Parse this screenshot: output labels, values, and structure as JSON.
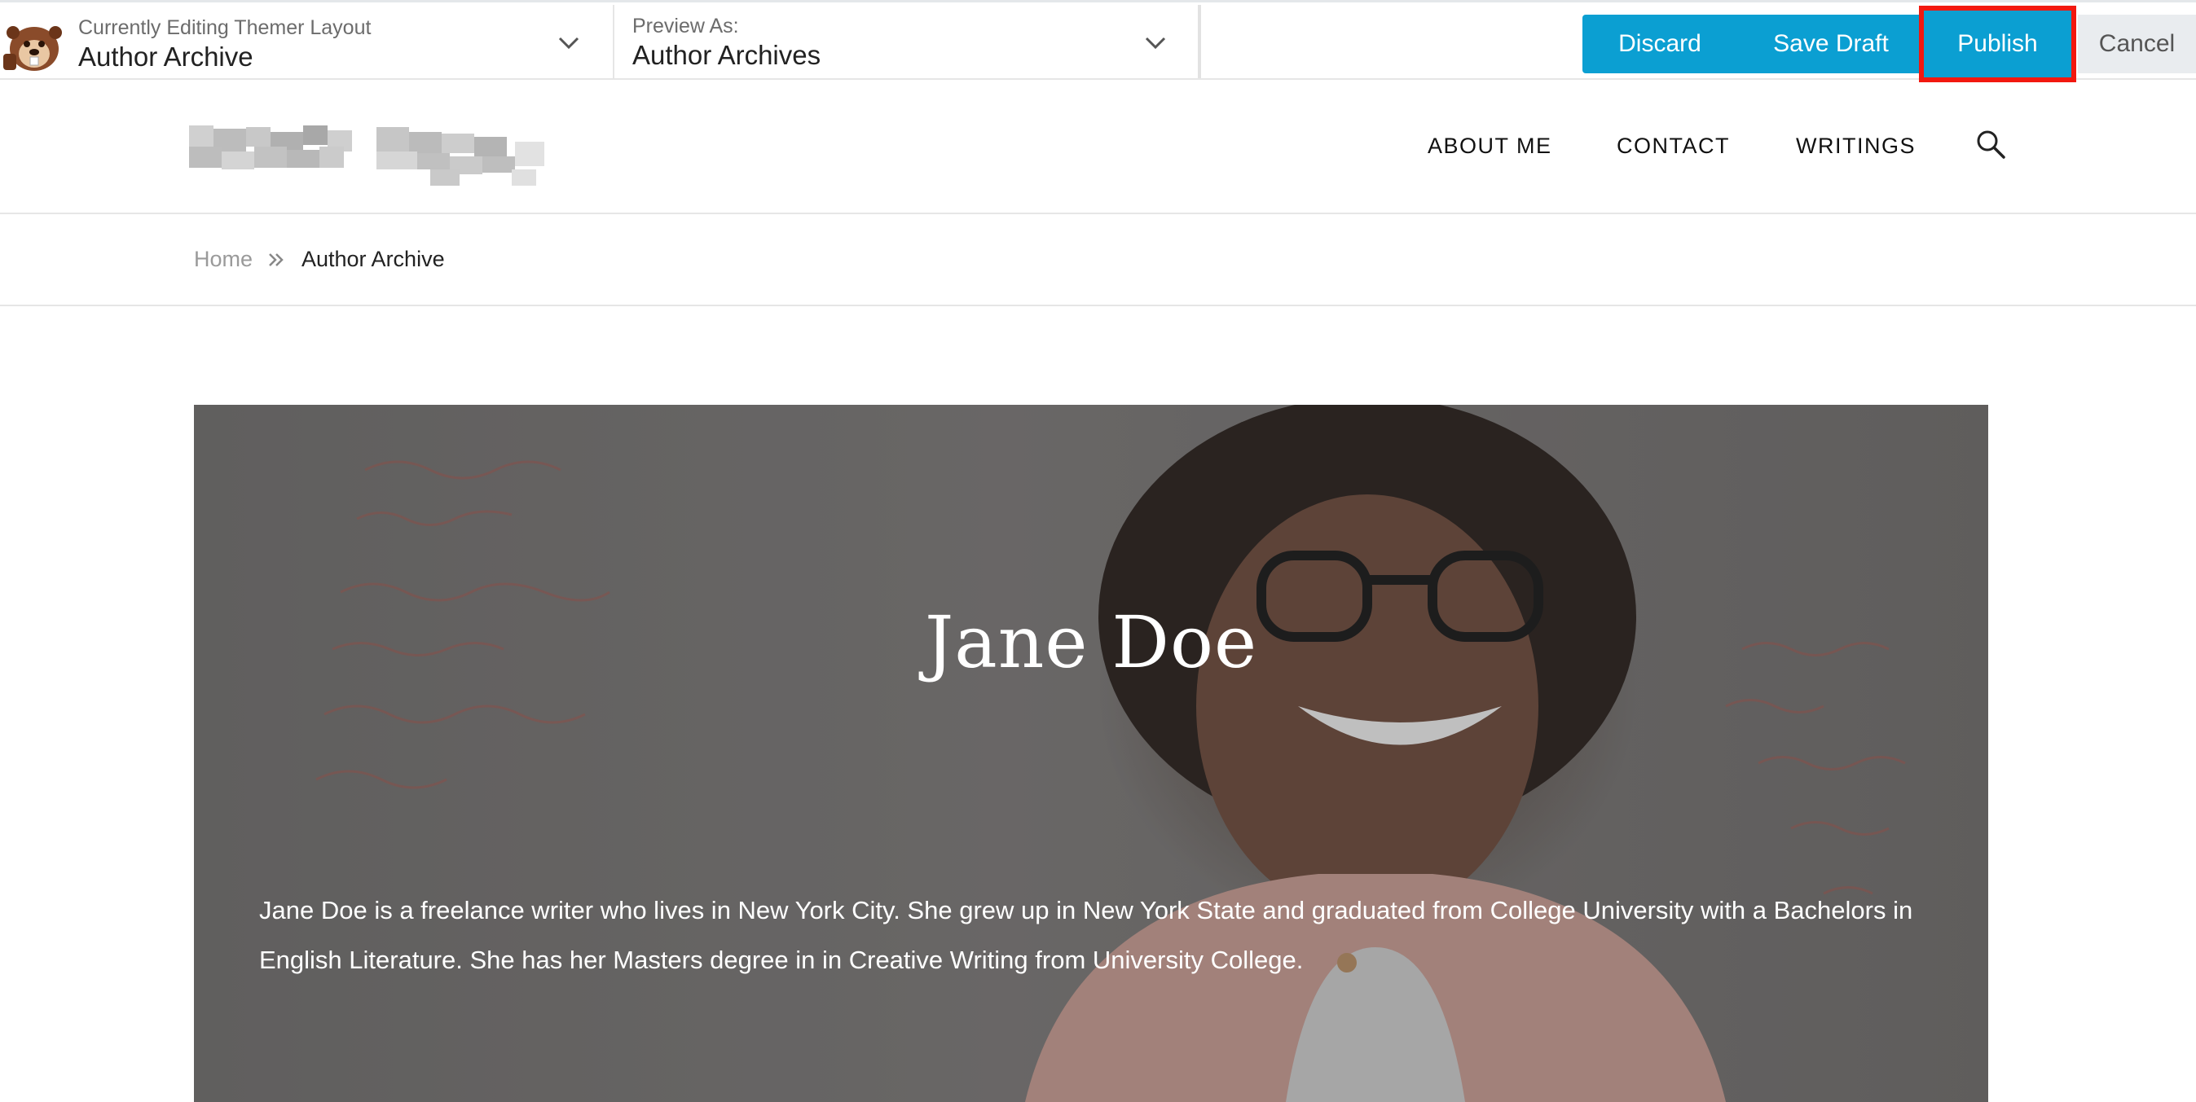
{
  "toolbar": {
    "layout_label": "Currently Editing Themer Layout",
    "layout_value": "Author Archive",
    "preview_label": "Preview As:",
    "preview_value": "Author Archives",
    "discard": "Discard",
    "save_draft": "Save Draft",
    "publish": "Publish",
    "cancel": "Cancel",
    "accent_color": "#0b9fd2",
    "highlight_color": "#f2180f"
  },
  "site": {
    "nav": [
      "ABOUT ME",
      "CONTACT",
      "WRITINGS"
    ]
  },
  "breadcrumb": {
    "home": "Home",
    "current": "Author Archive"
  },
  "hero": {
    "title": "Jane Doe",
    "bio": "Jane Doe is a freelance writer who lives in New York City. She grew up in New York State and graduated from College University with a Bachelors in English Literature. She has her Masters degree in in Creative Writing from University College."
  }
}
